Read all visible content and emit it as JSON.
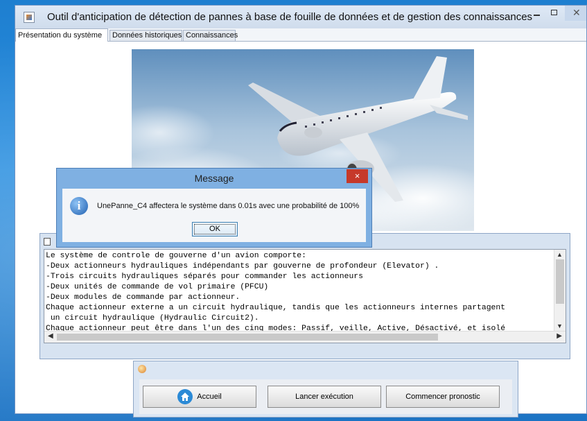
{
  "window": {
    "title": "Outil d'anticipation de détection de pannes à base de fouille de données et de gestion des connaissances"
  },
  "tabs": [
    {
      "label": "Présentation du système",
      "selected": true
    },
    {
      "label": "Données historiques",
      "selected": false
    },
    {
      "label": "Connaissances",
      "selected": false
    }
  ],
  "description": {
    "lines": [
      "Le système de controle de gouverne d'un avion comporte:",
      "-Deux actionneurs hydrauliques indépendants par gouverne de profondeur (Elevator) .",
      "-Trois circuits hydrauliques séparés pour commander les actionneurs",
      "-Deux unités de commande de vol primaire (PFCU)",
      "-Deux modules de commande par actionneur.",
      "Chaque actionneur externe a un circuit hydraulique, tandis que les actionneurs internes partagent",
      " un circuit hydraulique (Hydraulic Circuit2).",
      "Chaque actionneur peut être dans l'un des cinq modes: Passif, veille, Active, Désactivé, et isolé"
    ]
  },
  "navigation": {
    "home_label": "Accueil",
    "run_label": "Lancer exécution",
    "prognosis_label": "Commencer pronostic"
  },
  "dialog": {
    "title": "Message",
    "close_glyph": "×",
    "message": "UnePanne_C4 affectera le système dans 0.01s avec une probabilité de 100%",
    "ok_label": "OK",
    "icon": "info-icon"
  },
  "colors": {
    "desktop": "#1e7fd0",
    "dialog_frame": "#7fb0e2",
    "close_red": "#c6392a",
    "home_blue": "#2b8ad6"
  }
}
